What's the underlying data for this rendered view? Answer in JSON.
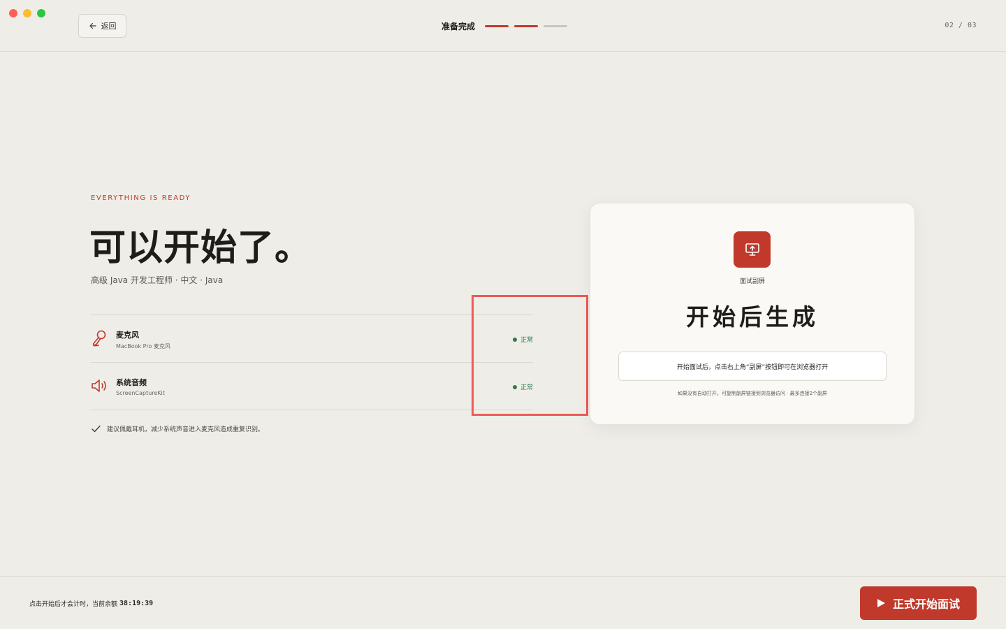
{
  "header": {
    "back_label": "返回",
    "step_label": "准备完成",
    "step_counter": "02 / 03",
    "steps": [
      "active",
      "active",
      "inactive"
    ]
  },
  "hero": {
    "eyebrow": "EVERYTHING IS READY",
    "title": "可以开始了。",
    "subtitle": "高级 Java 开发工程师 · 中文 · Java"
  },
  "devices": [
    {
      "name": "麦克风",
      "sub": "MacBook Pro 麦克风",
      "status": "正常",
      "icon": "microphone-icon"
    },
    {
      "name": "系统音频",
      "sub": "ScreenCaptureKit",
      "status": "正常",
      "icon": "speaker-icon"
    }
  ],
  "tip": "建议佩戴耳机，减少系统声音进入麦克风造成重复识别。",
  "card": {
    "icon": "screen-share-icon",
    "label": "面试副屏",
    "title": "开始后生成",
    "hint": "开始面试后，点击右上角“副屏”按钮即可在浏览器打开",
    "note": "如果没有自动打开，可复制副屏链接到浏览器访问 · 最多连接2个副屏"
  },
  "footer": {
    "note": "点击开始后才会计时，当前余额",
    "timer": "38:19:39",
    "start_label": "正式开始面试"
  },
  "colors": {
    "accent": "#c0392b",
    "status_ok": "#2f7a4b",
    "background": "#efede8",
    "highlight": "#ec5b58"
  }
}
